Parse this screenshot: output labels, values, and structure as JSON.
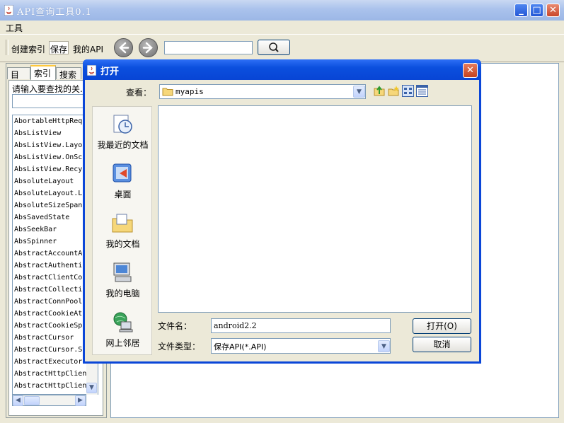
{
  "window": {
    "title": "API查询工具0.1"
  },
  "menu": {
    "tools": "工具"
  },
  "toolbar": {
    "create_index": "创建索引",
    "save": "保存",
    "my_api": "我的API",
    "search_value": ""
  },
  "left_panel": {
    "tabs": [
      "目录",
      "索引",
      "搜索"
    ],
    "active_tab": "索引",
    "prompt": "请输入要查找的关.",
    "index_input_value": "",
    "items": [
      "AbortableHttpReq",
      "AbsListView",
      "AbsListView.Layo",
      "AbsListView.OnSc",
      "AbsListView.Recy",
      "AbsoluteLayout",
      "AbsoluteLayout.L",
      "AbsoluteSizeSpan",
      "AbsSavedState",
      "AbsSeekBar",
      "AbsSpinner",
      "AbstractAccountA",
      "AbstractAuthenti",
      "AbstractClientCo",
      "AbstractCollecti",
      "AbstractConnPool",
      "AbstractCookieAt",
      "AbstractCookieSp",
      "AbstractCursor",
      "AbstractCursor.S",
      "AbstractExecutor",
      "AbstractHttpClien",
      "AbstractHttpClien"
    ]
  },
  "dialog": {
    "title": "打开",
    "look_in_label": "查看：",
    "look_in_value": "myapis",
    "places": [
      "我最近的文档",
      "桌面",
      "我的文档",
      "我的电脑",
      "网上邻居"
    ],
    "file_name_label": "文件名：",
    "file_name_value": "android2.2",
    "file_type_label": "文件类型：",
    "file_type_value": "保存API(*.API)",
    "open_button": "打开(O)",
    "cancel_button": "取消"
  }
}
